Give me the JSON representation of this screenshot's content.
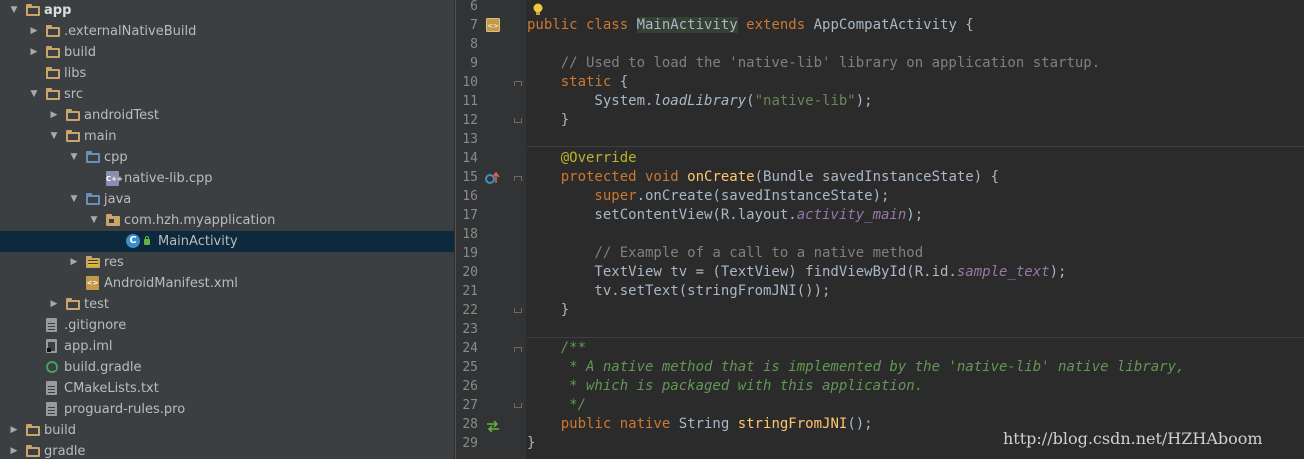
{
  "project_tree": {
    "items": [
      {
        "label": "app",
        "depth": 0,
        "expanded": true,
        "icon": "module-folder-icon",
        "bold": true
      },
      {
        "label": ".externalNativeBuild",
        "depth": 1,
        "expanded": false,
        "icon": "folder-icon"
      },
      {
        "label": "build",
        "depth": 1,
        "expanded": false,
        "icon": "folder-icon"
      },
      {
        "label": "libs",
        "depth": 1,
        "expanded": null,
        "icon": "folder-icon"
      },
      {
        "label": "src",
        "depth": 1,
        "expanded": true,
        "icon": "folder-icon"
      },
      {
        "label": "androidTest",
        "depth": 2,
        "expanded": false,
        "icon": "folder-icon"
      },
      {
        "label": "main",
        "depth": 2,
        "expanded": true,
        "icon": "folder-icon"
      },
      {
        "label": "cpp",
        "depth": 3,
        "expanded": true,
        "icon": "source-folder-icon"
      },
      {
        "label": "native-lib.cpp",
        "depth": 4,
        "expanded": null,
        "icon": "cpp-file-icon"
      },
      {
        "label": "java",
        "depth": 3,
        "expanded": true,
        "icon": "source-folder-icon"
      },
      {
        "label": "com.hzh.myapplication",
        "depth": 4,
        "expanded": true,
        "icon": "package-icon"
      },
      {
        "label": "MainActivity",
        "depth": 5,
        "expanded": null,
        "icon": "class-icon",
        "selected": true
      },
      {
        "label": "res",
        "depth": 3,
        "expanded": false,
        "icon": "resource-folder-icon"
      },
      {
        "label": "AndroidManifest.xml",
        "depth": 3,
        "expanded": null,
        "icon": "manifest-icon"
      },
      {
        "label": "test",
        "depth": 2,
        "expanded": false,
        "icon": "folder-icon"
      },
      {
        "label": ".gitignore",
        "depth": 1,
        "expanded": null,
        "icon": "text-file-icon"
      },
      {
        "label": "app.iml",
        "depth": 1,
        "expanded": null,
        "icon": "iml-file-icon"
      },
      {
        "label": "build.gradle",
        "depth": 1,
        "expanded": null,
        "icon": "gradle-icon"
      },
      {
        "label": "CMakeLists.txt",
        "depth": 1,
        "expanded": null,
        "icon": "text-file-icon"
      },
      {
        "label": "proguard-rules.pro",
        "depth": 1,
        "expanded": null,
        "icon": "text-file-icon"
      },
      {
        "label": "build",
        "depth": 0,
        "expanded": false,
        "icon": "folder-icon"
      },
      {
        "label": "gradle",
        "depth": 0,
        "expanded": false,
        "icon": "folder-icon"
      }
    ]
  },
  "editor": {
    "line_numbers": [
      "6",
      "7",
      "8",
      "9",
      "10",
      "11",
      "12",
      "13",
      "14",
      "15",
      "16",
      "17",
      "18",
      "19",
      "20",
      "21",
      "22",
      "23",
      "24",
      "25",
      "26",
      "27",
      "28",
      "29"
    ],
    "lines": [
      [],
      [
        [
          "kw",
          "public class "
        ],
        [
          "hl",
          "MainActivity"
        ],
        [
          "kw",
          " extends "
        ],
        [
          "cls",
          "AppCompatActivity {"
        ]
      ],
      [],
      [
        [
          "cmt",
          "    // Used to load the 'native-lib' library on application startup."
        ]
      ],
      [
        [
          "kw",
          "    static "
        ],
        [
          "cls",
          "{"
        ]
      ],
      [
        [
          "cls",
          "        System."
        ],
        [
          "it",
          "loadLibrary"
        ],
        [
          "cls",
          "("
        ],
        [
          "str",
          "\"native-lib\""
        ],
        [
          "cls",
          ");"
        ]
      ],
      [
        [
          "cls",
          "    }"
        ]
      ],
      [],
      [
        [
          "ann",
          "    @Override"
        ]
      ],
      [
        [
          "kw",
          "    protected void "
        ],
        [
          "fn",
          "onCreate"
        ],
        [
          "cls",
          "(Bundle savedInstanceState) {"
        ]
      ],
      [
        [
          "kw",
          "        super"
        ],
        [
          "cls",
          ".onCreate(savedInstanceState);"
        ]
      ],
      [
        [
          "cls",
          "        setContentView(R.layout."
        ],
        [
          "field",
          "activity_main"
        ],
        [
          "cls",
          ");"
        ]
      ],
      [],
      [
        [
          "cmt",
          "        // Example of a call to a native method"
        ]
      ],
      [
        [
          "cls",
          "        TextView tv = (TextView) findViewById(R.id."
        ],
        [
          "field",
          "sample_text"
        ],
        [
          "cls",
          ");"
        ]
      ],
      [
        [
          "cls",
          "        tv.setText(stringFromJNI());"
        ]
      ],
      [
        [
          "cls",
          "    }"
        ]
      ],
      [],
      [
        [
          "doc",
          "    /**"
        ]
      ],
      [
        [
          "doc",
          "     * A native method that is implemented by the 'native-lib' native library,"
        ]
      ],
      [
        [
          "doc",
          "     * which is packaged with this application."
        ]
      ],
      [
        [
          "doc",
          "     */"
        ]
      ],
      [
        [
          "kw",
          "    public native "
        ],
        [
          "cls",
          "String "
        ],
        [
          "fn",
          "stringFromJNI"
        ],
        [
          "cls",
          "();"
        ]
      ],
      [
        [
          "cls",
          "}"
        ]
      ]
    ]
  },
  "watermark": "http://blog.csdn.net/HZHAboom",
  "colors": {
    "keyword": "#cc7832",
    "comment": "#808080",
    "doc_comment": "#629755",
    "string": "#6a8759",
    "function": "#ffc66d",
    "field": "#9876aa",
    "annotation": "#bbb529",
    "selection": "#0d293e"
  }
}
